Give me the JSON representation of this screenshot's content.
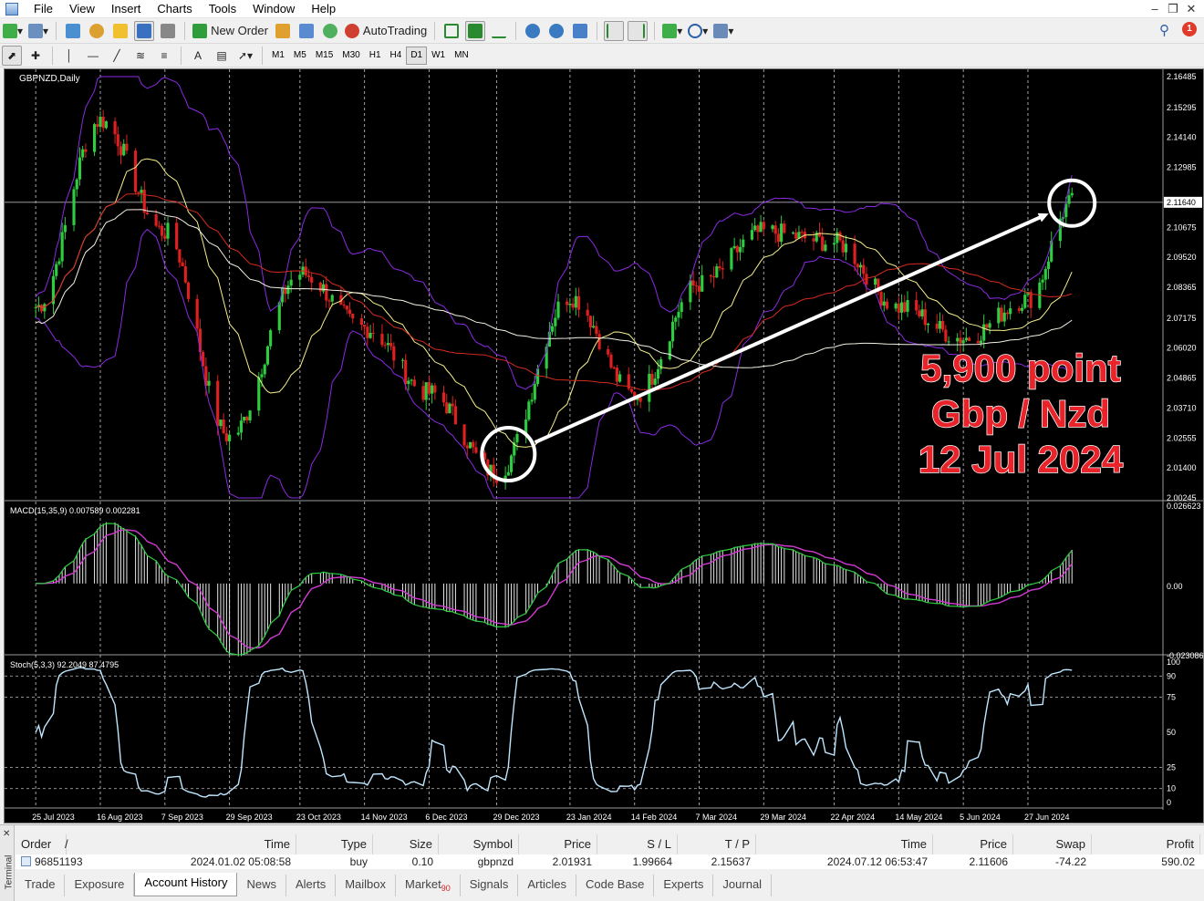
{
  "menu": {
    "items": [
      "File",
      "View",
      "Insert",
      "Charts",
      "Tools",
      "Window",
      "Help"
    ]
  },
  "toolbar": {
    "new_order_label": "New Order",
    "autotrading_label": "AutoTrading",
    "timeframes": [
      "M1",
      "M5",
      "M15",
      "M30",
      "H1",
      "H4",
      "D1",
      "W1",
      "MN"
    ],
    "active_timeframe": "D1",
    "notification_count": "1"
  },
  "chart": {
    "symbol_label": "GBPNZD,Daily",
    "current_price": "2.11640",
    "annotation": {
      "line1": "5,900 point",
      "line2": "Gbp / Nzd",
      "line3": "12 Jul 2024",
      "color": "#e8232a"
    },
    "colors": {
      "background": "#000000",
      "bull_candle": "#2ecc40",
      "bear_candle": "#e02020",
      "bollinger": "#8a2be2",
      "ma_fast": "#f5f08a",
      "ma_mid": "#d42a1e",
      "ma_slow": "#f2f2e4",
      "macd_signal": "#d13ad1",
      "macd_main": "#2ecc40",
      "stoch": "#bfe6ff"
    }
  },
  "chart_data": {
    "type": "line",
    "price_axis_ticks": [
      "2.16485",
      "2.15295",
      "2.14140",
      "2.12985",
      "2.11640",
      "2.10675",
      "2.09520",
      "2.08365",
      "2.07175",
      "2.06020",
      "2.04865",
      "2.03710",
      "2.02555",
      "2.01400",
      "2.00245"
    ],
    "price_ylim": [
      2.00245,
      2.16485
    ],
    "date_axis_ticks": [
      "25 Jul 2023",
      "16 Aug 2023",
      "7 Sep 2023",
      "29 Sep 2023",
      "23 Oct 2023",
      "14 Nov 2023",
      "6 Dec 2023",
      "29 Dec 2023",
      "23 Jan 2024",
      "14 Feb 2024",
      "7 Mar 2024",
      "29 Mar 2024",
      "22 Apr 2024",
      "14 May 2024",
      "5 Jun 2024",
      "27 Jun 2024"
    ],
    "price_series": [
      {
        "x": "25 Jul 2023",
        "y": 2.076
      },
      {
        "x": "16 Aug 2023",
        "y": 2.148
      },
      {
        "x": "7 Sep 2023",
        "y": 2.105
      },
      {
        "x": "29 Sep 2023",
        "y": 2.026
      },
      {
        "x": "23 Oct 2023",
        "y": 2.089
      },
      {
        "x": "14 Nov 2023",
        "y": 2.068
      },
      {
        "x": "6 Dec 2023",
        "y": 2.043
      },
      {
        "x": "29 Dec 2023",
        "y": 2.012
      },
      {
        "x": "23 Jan 2024",
        "y": 2.08
      },
      {
        "x": "14 Feb 2024",
        "y": 2.042
      },
      {
        "x": "7 Mar 2024",
        "y": 2.085
      },
      {
        "x": "29 Mar 2024",
        "y": 2.105
      },
      {
        "x": "22 Apr 2024",
        "y": 2.101
      },
      {
        "x": "14 May 2024",
        "y": 2.076
      },
      {
        "x": "5 Jun 2024",
        "y": 2.064
      },
      {
        "x": "27 Jun 2024",
        "y": 2.079
      },
      {
        "x": "12 Jul 2024",
        "y": 2.1164
      }
    ],
    "macd": {
      "label": "MACD(15,35,9) 0.007589 0.002281",
      "axis_ticks": [
        "0.026623",
        "0.00",
        "-0.023086"
      ],
      "ylim": [
        -0.023086,
        0.026623
      ]
    },
    "stochastic": {
      "label": "Stoch(5,3,3) 92.2049 87.4795",
      "axis_ticks": [
        "100",
        "90",
        "75",
        "50",
        "25",
        "10",
        "0"
      ],
      "ylim": [
        0,
        100
      ]
    },
    "trade_arrow": {
      "from": {
        "x": "2 Jan 2024",
        "y": 2.01931
      },
      "to": {
        "x": "12 Jul 2024",
        "y": 2.11606
      }
    }
  },
  "terminal": {
    "side_label": "Terminal",
    "columns": [
      "Order",
      "/",
      "Time",
      "Type",
      "Size",
      "Symbol",
      "Price",
      "S / L",
      "T / P",
      "Time",
      "Price",
      "Swap",
      "Profit"
    ],
    "rows": [
      {
        "order": "96851193",
        "open_time": "2024.01.02 05:08:58",
        "type": "buy",
        "size": "0.10",
        "symbol": "gbpnzd",
        "open_price": "2.01931",
        "sl": "1.99664",
        "tp": "2.15637",
        "close_time": "2024.07.12 06:53:47",
        "close_price": "2.11606",
        "swap": "-74.22",
        "profit": "590.02"
      }
    ],
    "tabs": [
      "Trade",
      "Exposure",
      "Account History",
      "News",
      "Alerts",
      "Mailbox",
      "Market",
      "Signals",
      "Articles",
      "Code Base",
      "Experts",
      "Journal"
    ],
    "market_badge": "90",
    "active_tab": "Account History"
  }
}
